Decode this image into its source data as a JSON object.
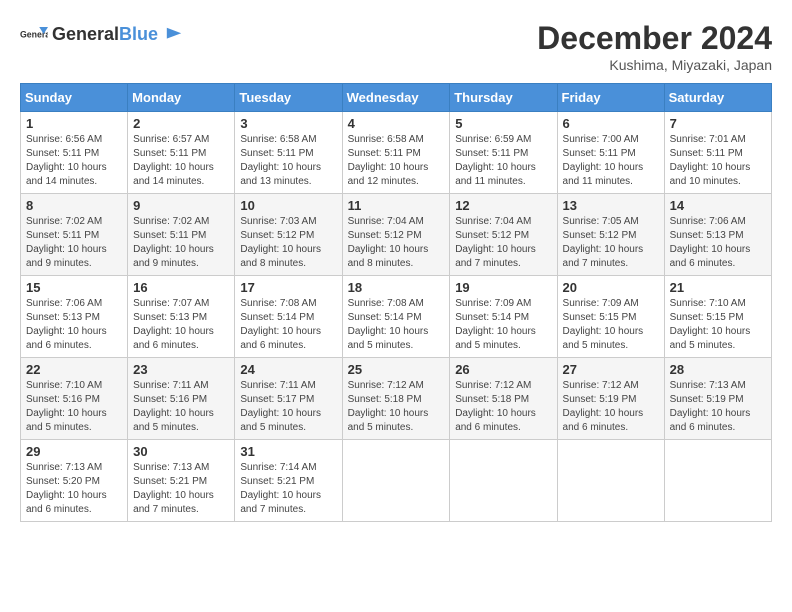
{
  "logo": {
    "general": "General",
    "blue": "Blue"
  },
  "title": {
    "month_year": "December 2024",
    "location": "Kushima, Miyazaki, Japan"
  },
  "weekdays": [
    "Sunday",
    "Monday",
    "Tuesday",
    "Wednesday",
    "Thursday",
    "Friday",
    "Saturday"
  ],
  "weeks": [
    [
      {
        "day": "1",
        "sunrise": "6:56 AM",
        "sunset": "5:11 PM",
        "daylight": "10 hours and 14 minutes."
      },
      {
        "day": "2",
        "sunrise": "6:57 AM",
        "sunset": "5:11 PM",
        "daylight": "10 hours and 14 minutes."
      },
      {
        "day": "3",
        "sunrise": "6:58 AM",
        "sunset": "5:11 PM",
        "daylight": "10 hours and 13 minutes."
      },
      {
        "day": "4",
        "sunrise": "6:58 AM",
        "sunset": "5:11 PM",
        "daylight": "10 hours and 12 minutes."
      },
      {
        "day": "5",
        "sunrise": "6:59 AM",
        "sunset": "5:11 PM",
        "daylight": "10 hours and 11 minutes."
      },
      {
        "day": "6",
        "sunrise": "7:00 AM",
        "sunset": "5:11 PM",
        "daylight": "10 hours and 11 minutes."
      },
      {
        "day": "7",
        "sunrise": "7:01 AM",
        "sunset": "5:11 PM",
        "daylight": "10 hours and 10 minutes."
      }
    ],
    [
      {
        "day": "8",
        "sunrise": "7:02 AM",
        "sunset": "5:11 PM",
        "daylight": "10 hours and 9 minutes."
      },
      {
        "day": "9",
        "sunrise": "7:02 AM",
        "sunset": "5:11 PM",
        "daylight": "10 hours and 9 minutes."
      },
      {
        "day": "10",
        "sunrise": "7:03 AM",
        "sunset": "5:12 PM",
        "daylight": "10 hours and 8 minutes."
      },
      {
        "day": "11",
        "sunrise": "7:04 AM",
        "sunset": "5:12 PM",
        "daylight": "10 hours and 8 minutes."
      },
      {
        "day": "12",
        "sunrise": "7:04 AM",
        "sunset": "5:12 PM",
        "daylight": "10 hours and 7 minutes."
      },
      {
        "day": "13",
        "sunrise": "7:05 AM",
        "sunset": "5:12 PM",
        "daylight": "10 hours and 7 minutes."
      },
      {
        "day": "14",
        "sunrise": "7:06 AM",
        "sunset": "5:13 PM",
        "daylight": "10 hours and 6 minutes."
      }
    ],
    [
      {
        "day": "15",
        "sunrise": "7:06 AM",
        "sunset": "5:13 PM",
        "daylight": "10 hours and 6 minutes."
      },
      {
        "day": "16",
        "sunrise": "7:07 AM",
        "sunset": "5:13 PM",
        "daylight": "10 hours and 6 minutes."
      },
      {
        "day": "17",
        "sunrise": "7:08 AM",
        "sunset": "5:14 PM",
        "daylight": "10 hours and 6 minutes."
      },
      {
        "day": "18",
        "sunrise": "7:08 AM",
        "sunset": "5:14 PM",
        "daylight": "10 hours and 5 minutes."
      },
      {
        "day": "19",
        "sunrise": "7:09 AM",
        "sunset": "5:14 PM",
        "daylight": "10 hours and 5 minutes."
      },
      {
        "day": "20",
        "sunrise": "7:09 AM",
        "sunset": "5:15 PM",
        "daylight": "10 hours and 5 minutes."
      },
      {
        "day": "21",
        "sunrise": "7:10 AM",
        "sunset": "5:15 PM",
        "daylight": "10 hours and 5 minutes."
      }
    ],
    [
      {
        "day": "22",
        "sunrise": "7:10 AM",
        "sunset": "5:16 PM",
        "daylight": "10 hours and 5 minutes."
      },
      {
        "day": "23",
        "sunrise": "7:11 AM",
        "sunset": "5:16 PM",
        "daylight": "10 hours and 5 minutes."
      },
      {
        "day": "24",
        "sunrise": "7:11 AM",
        "sunset": "5:17 PM",
        "daylight": "10 hours and 5 minutes."
      },
      {
        "day": "25",
        "sunrise": "7:12 AM",
        "sunset": "5:18 PM",
        "daylight": "10 hours and 5 minutes."
      },
      {
        "day": "26",
        "sunrise": "7:12 AM",
        "sunset": "5:18 PM",
        "daylight": "10 hours and 6 minutes."
      },
      {
        "day": "27",
        "sunrise": "7:12 AM",
        "sunset": "5:19 PM",
        "daylight": "10 hours and 6 minutes."
      },
      {
        "day": "28",
        "sunrise": "7:13 AM",
        "sunset": "5:19 PM",
        "daylight": "10 hours and 6 minutes."
      }
    ],
    [
      {
        "day": "29",
        "sunrise": "7:13 AM",
        "sunset": "5:20 PM",
        "daylight": "10 hours and 6 minutes."
      },
      {
        "day": "30",
        "sunrise": "7:13 AM",
        "sunset": "5:21 PM",
        "daylight": "10 hours and 7 minutes."
      },
      {
        "day": "31",
        "sunrise": "7:14 AM",
        "sunset": "5:21 PM",
        "daylight": "10 hours and 7 minutes."
      },
      null,
      null,
      null,
      null
    ]
  ]
}
